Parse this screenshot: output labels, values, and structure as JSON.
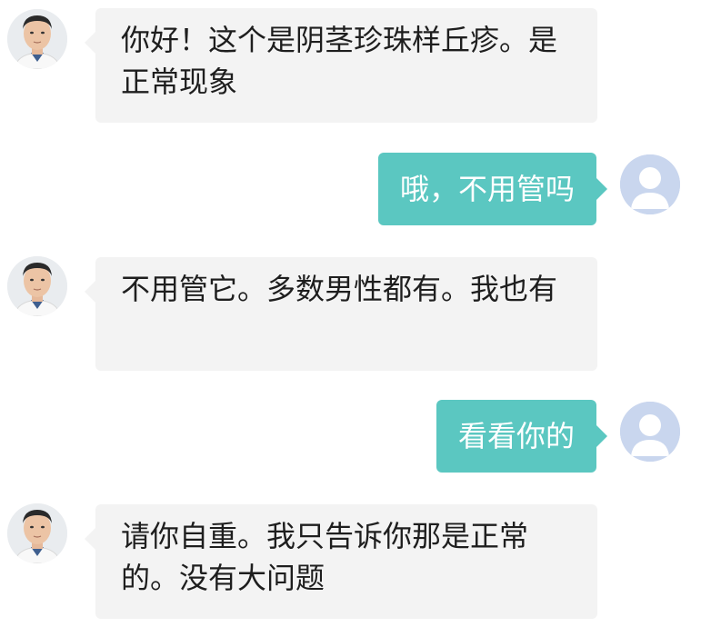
{
  "colors": {
    "background": "#ffffff",
    "doctor_bubble": "#f3f3f3",
    "user_bubble": "#5bc7c1",
    "user_avatar": "#c9d6ee",
    "text_dark": "#1e1e1e",
    "text_light": "#ffffff"
  },
  "messages": [
    {
      "sender": "doctor",
      "avatar_icon": "doctor-avatar-icon",
      "text": "你好！这个是阴茎珍珠样丘疹。是正常现象"
    },
    {
      "sender": "user",
      "avatar_icon": "user-avatar-icon",
      "text": "哦，不用管吗"
    },
    {
      "sender": "doctor",
      "avatar_icon": "doctor-avatar-icon",
      "text": "不用管它。多数男性都有。我也有"
    },
    {
      "sender": "user",
      "avatar_icon": "user-avatar-icon",
      "text": "看看你的"
    },
    {
      "sender": "doctor",
      "avatar_icon": "doctor-avatar-icon",
      "text": "请你自重。我只告诉你那是正常的。没有大问题"
    }
  ]
}
